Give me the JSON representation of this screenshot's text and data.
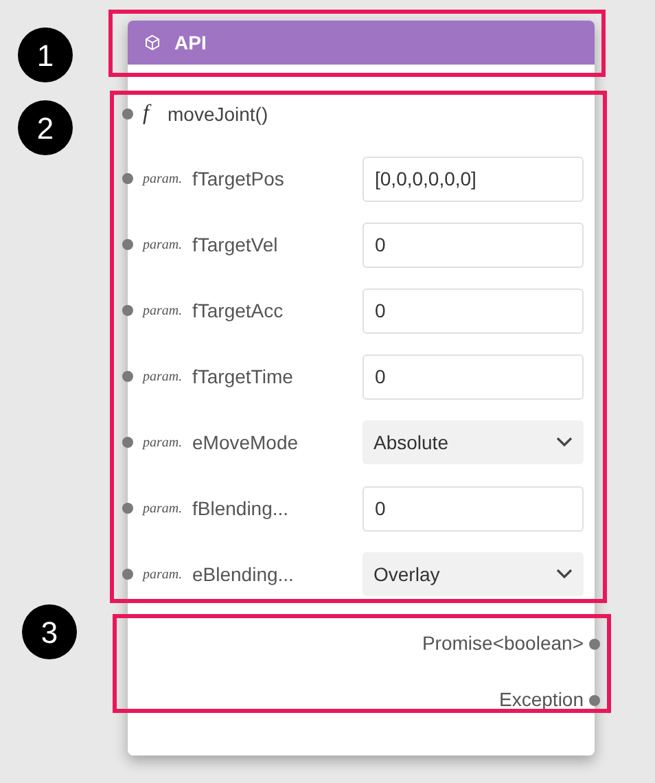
{
  "node": {
    "title": "API",
    "function": {
      "prefix": "f",
      "name": "moveJoint()"
    },
    "params": [
      {
        "tag": "param.",
        "name": "fTargetPos",
        "kind": "input",
        "value": "[0,0,0,0,0,0]"
      },
      {
        "tag": "param.",
        "name": "fTargetVel",
        "kind": "input",
        "value": "0"
      },
      {
        "tag": "param.",
        "name": "fTargetAcc",
        "kind": "input",
        "value": "0"
      },
      {
        "tag": "param.",
        "name": "fTargetTime",
        "kind": "input",
        "value": "0"
      },
      {
        "tag": "param.",
        "name": "eMoveMode",
        "kind": "select",
        "value": "Absolute"
      },
      {
        "tag": "param.",
        "name": "fBlending...",
        "kind": "input",
        "value": "0"
      },
      {
        "tag": "param.",
        "name": "eBlending...",
        "kind": "select",
        "value": "Overlay"
      }
    ],
    "outputs": [
      {
        "label": "Promise<boolean>"
      },
      {
        "label": "Exception"
      }
    ]
  },
  "callouts": [
    {
      "number": "1"
    },
    {
      "number": "2"
    },
    {
      "number": "3"
    }
  ]
}
